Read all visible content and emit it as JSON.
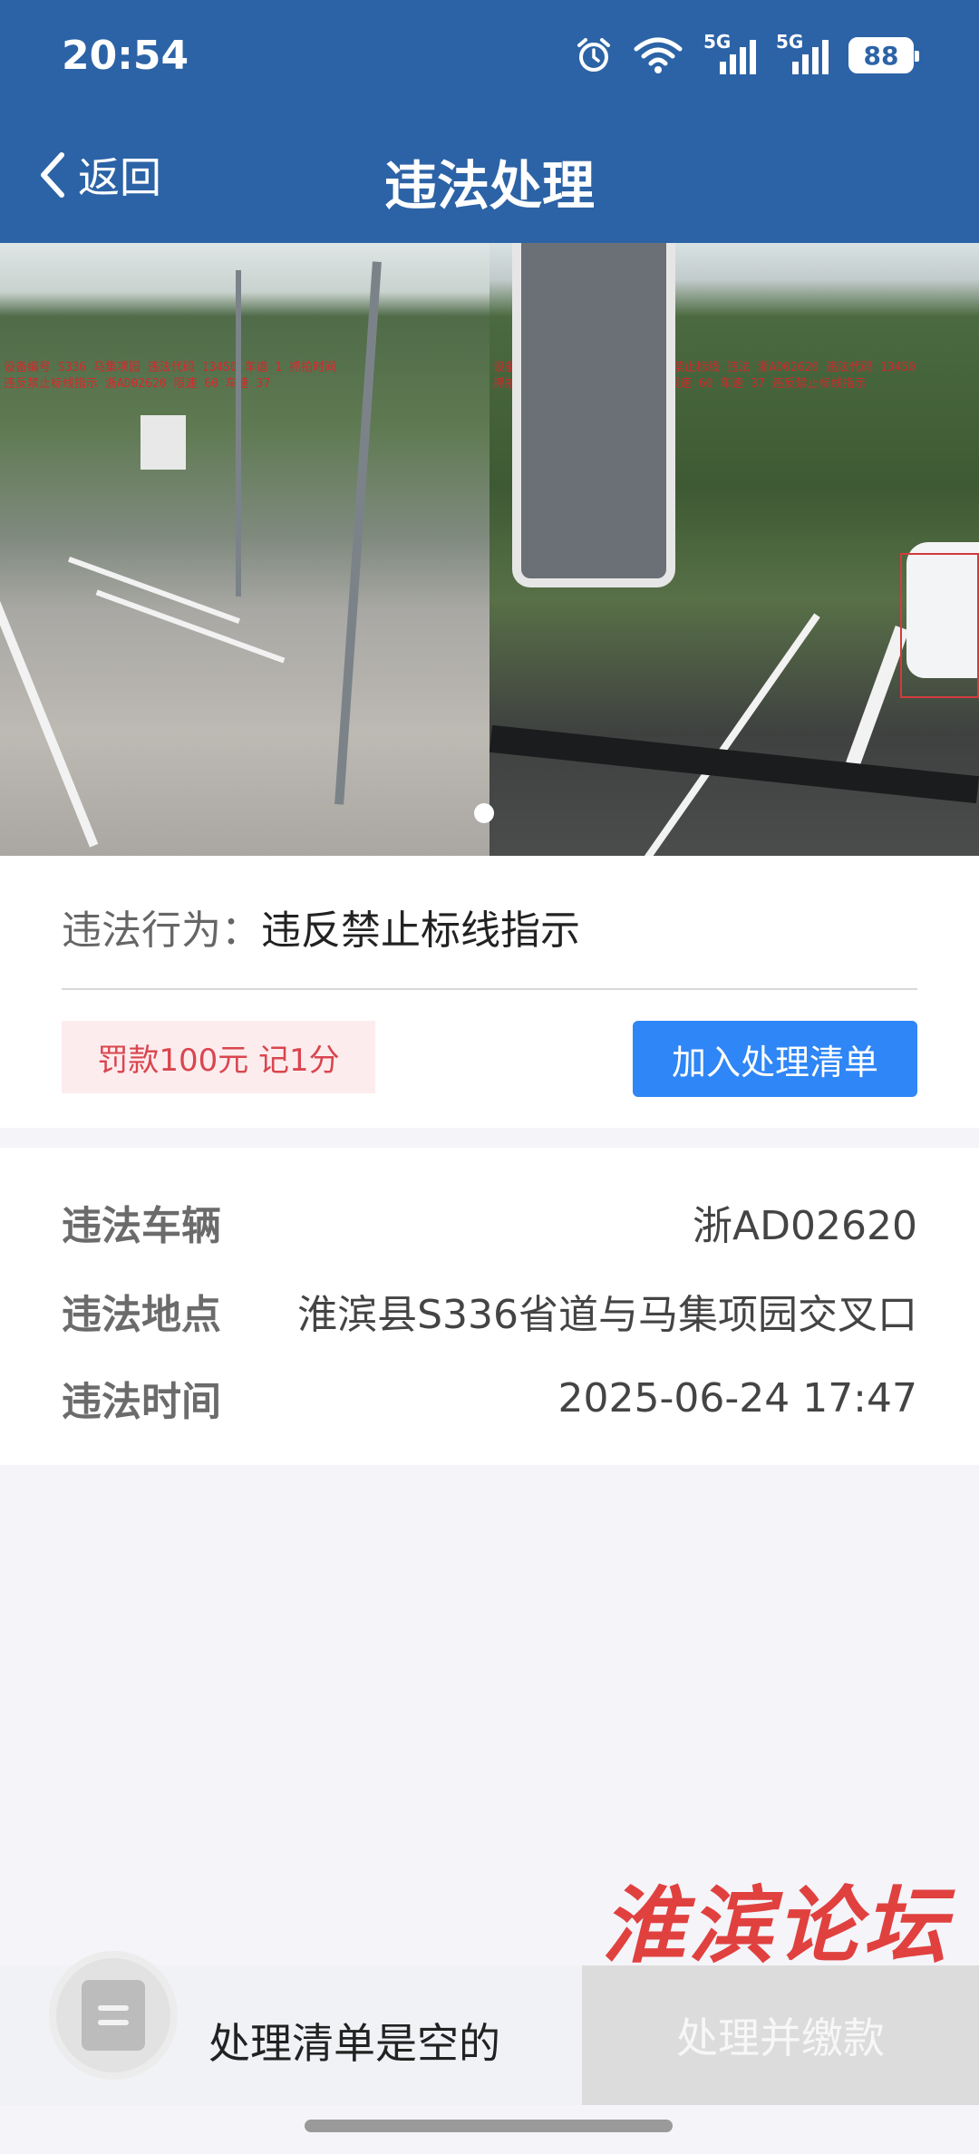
{
  "status_bar": {
    "time": "20:54",
    "network_1": "5G",
    "network_2": "5G",
    "battery": "88",
    "icons": [
      "alarm-icon",
      "wifi-icon",
      "signal-icon",
      "signal-icon",
      "battery-icon"
    ]
  },
  "header": {
    "back_label": "返回",
    "title": "违法处理",
    "background_color": "#2c63a6"
  },
  "violation": {
    "behavior_key": "违法行为：",
    "behavior_value": "违反禁止标线指示",
    "fine_text": "罚款100元 记1分",
    "add_button": "加入处理清单"
  },
  "details": {
    "vehicle_key": "违法车辆",
    "vehicle_value": "浙AD02620",
    "location_key": "违法地点",
    "location_value": "淮滨县S336省道与马集项园交叉口",
    "time_key": "违法时间",
    "time_value": "2025-06-24 17:47"
  },
  "watermark": "淮滨论坛",
  "bottom_bar": {
    "empty_text": "处理清单是空的",
    "pay_button": "处理并缴款"
  }
}
